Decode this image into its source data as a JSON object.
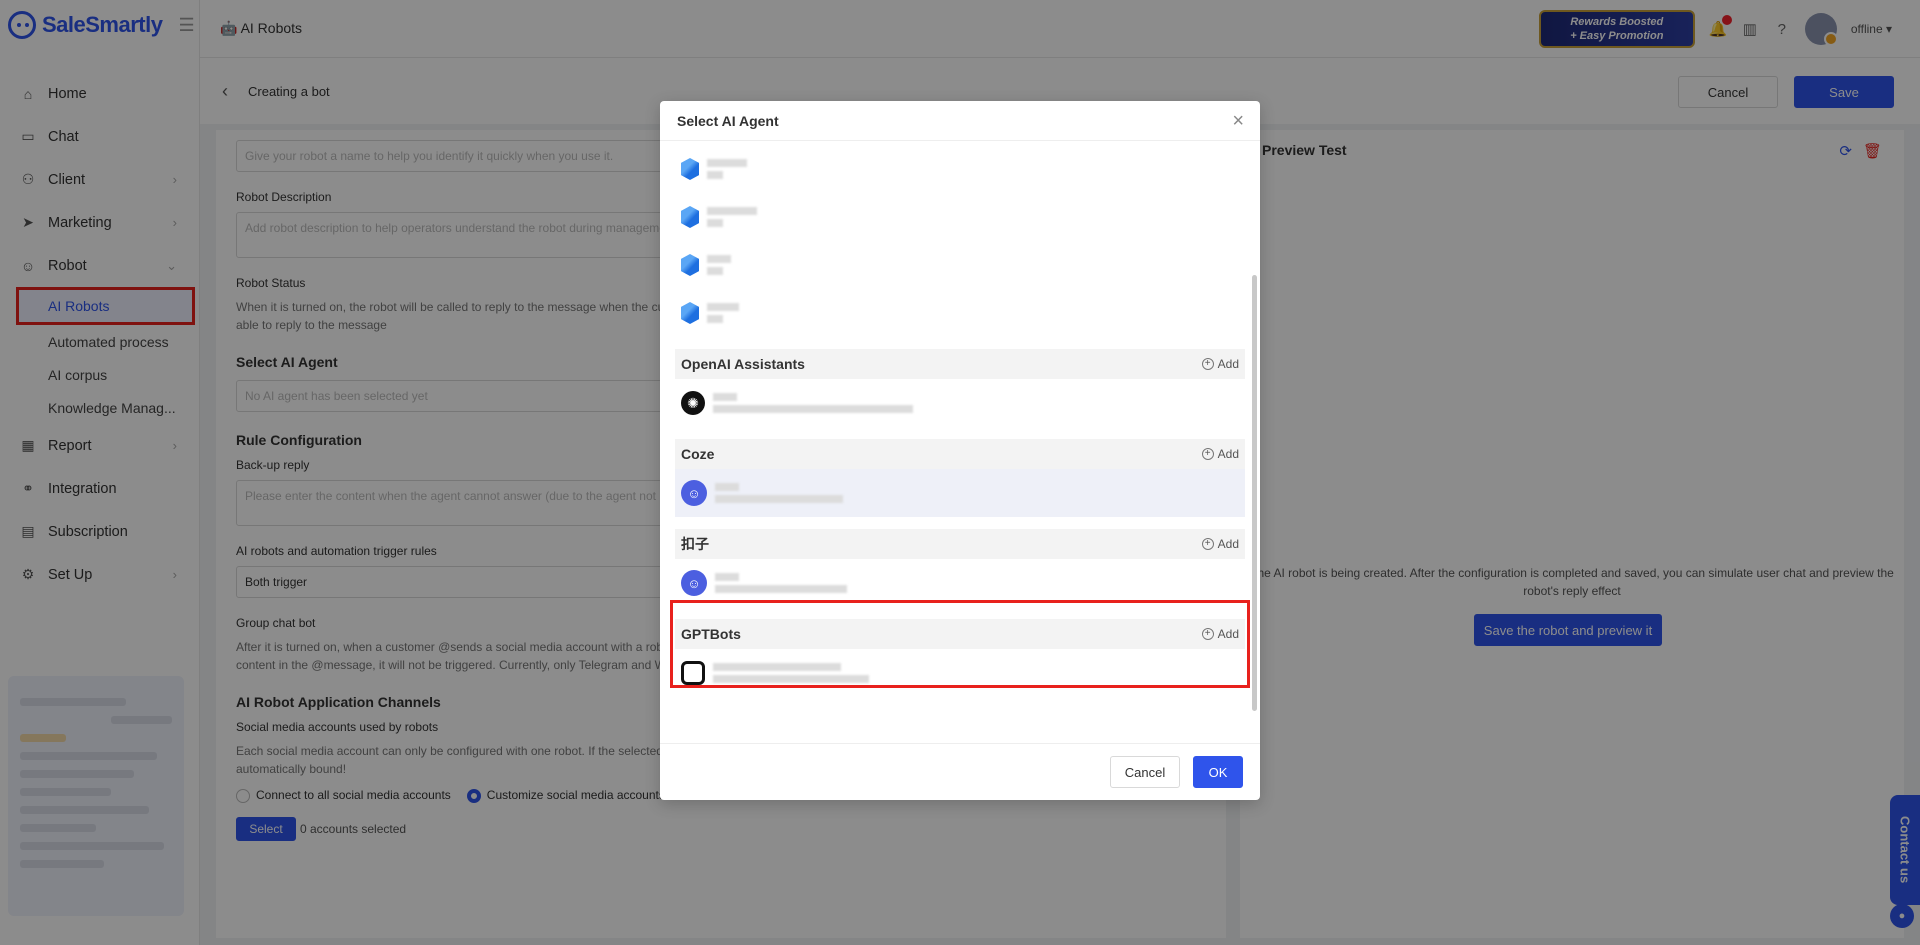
{
  "brand": {
    "name": "SaleSmartly"
  },
  "sidebar": {
    "items": [
      {
        "label": "Home"
      },
      {
        "label": "Chat"
      },
      {
        "label": "Client"
      },
      {
        "label": "Marketing"
      },
      {
        "label": "Robot"
      },
      {
        "label": "Report"
      },
      {
        "label": "Integration"
      },
      {
        "label": "Subscription"
      },
      {
        "label": "Set Up"
      }
    ],
    "robot_sub": [
      "AI Robots",
      "Automated process",
      "AI corpus",
      "Knowledge Manag..."
    ]
  },
  "topbar": {
    "crumb": "AI Robots",
    "rewards_line1": "Rewards Boosted",
    "rewards_line2": "+ Easy Promotion",
    "status": "offline"
  },
  "editor": {
    "back_title": "Creating a bot",
    "cancel": "Cancel",
    "save": "Save",
    "name_placeholder": "Give your robot a name to help you identify it quickly when you use it.",
    "desc_label": "Robot Description",
    "desc_placeholder": "Add robot description to help operators understand the robot during management",
    "status_label": "Robot Status",
    "status_help": "When it is turned on, the robot will be called to reply to the message when the customer sends a message. When it is turned off, the robot will not be able to reply to the message",
    "agent_section": "Select AI Agent",
    "agent_placeholder": "No AI agent has been selected yet",
    "rule_section": "Rule Configuration",
    "backup_label": "Back-up reply",
    "backup_placeholder": "Please enter the content when the agent cannot answer (due to the agent not responding",
    "trigger_label": "AI robots and automation trigger rules",
    "trigger_value": "Both trigger",
    "group_label": "Group chat bot",
    "group_help": "After it is turned on, when a customer @sends a social media account with a robot in a group chat, the robot will reply to the message. If there is no content in the @message, it will not be triggered. Currently, only Telegram and WhatsApp groups are supported",
    "channels_section": "AI Robot Application Channels",
    "channels_label": "Social media accounts used by robots",
    "channels_help": "Each social media account can only be configured with one robot. If the selected social media account already has a robot, the latest one will be automatically bound!",
    "radio_all": "Connect to all social media accounts",
    "radio_custom": "Customize social media accounts",
    "select_btn": "Select",
    "accounts_selected": "0 accounts selected"
  },
  "preview": {
    "title": "Preview Test",
    "message": "The AI robot is being created. After the configuration is completed and saved, you can simulate user chat and preview the robot's reply effect",
    "button": "Save the robot and preview it"
  },
  "contact": {
    "label": "Contact us"
  },
  "modal": {
    "title": "Select AI Agent",
    "add_label": "Add",
    "groups": [
      {
        "name": "OpenAI Assistants"
      },
      {
        "name": "Coze"
      },
      {
        "name": "扣子"
      },
      {
        "name": "GPTBots"
      }
    ],
    "cancel": "Cancel",
    "ok": "OK"
  },
  "colors": {
    "accent": "#2f54eb",
    "highlight": "#e8211d"
  }
}
